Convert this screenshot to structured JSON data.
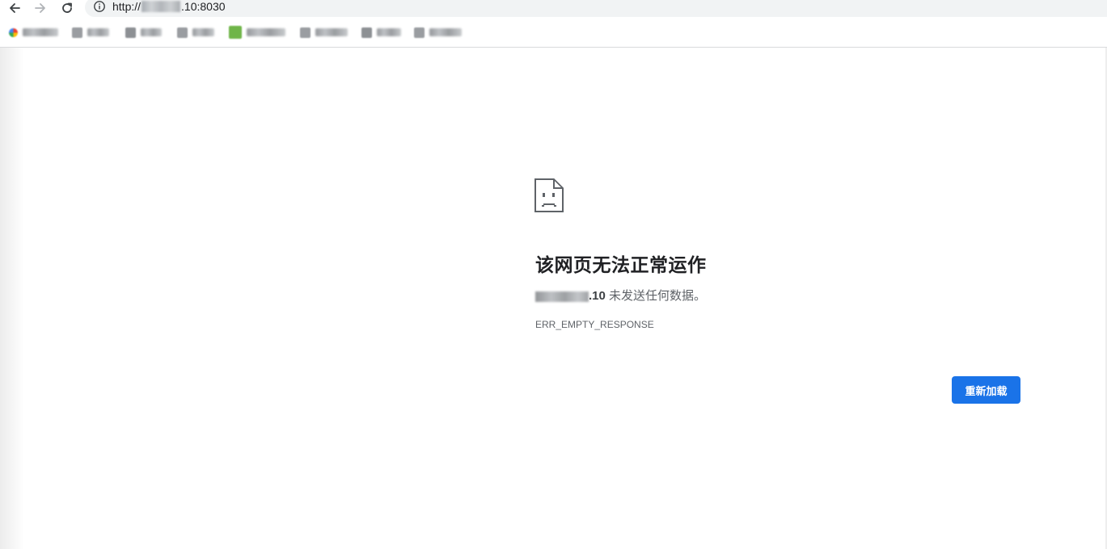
{
  "browser": {
    "url_prefix": "http://",
    "url_suffix": ".10:8030",
    "bookmarks_count_visible": 8
  },
  "error_page": {
    "title": "该网页无法正常运作",
    "host_suffix": ".10",
    "detail": " 未发送任何数据。",
    "error_code": "ERR_EMPTY_RESPONSE",
    "reload_label": "重新加载"
  },
  "colors": {
    "accent": "#1a73e8",
    "title_text": "#202124",
    "secondary_text": "#5f6368",
    "omnibox_bg": "#f1f3f4"
  },
  "icons": {
    "back": "arrow-left",
    "forward": "arrow-right",
    "reload": "circular-arrow",
    "site_info": "info-circle",
    "error": "sad-document"
  }
}
